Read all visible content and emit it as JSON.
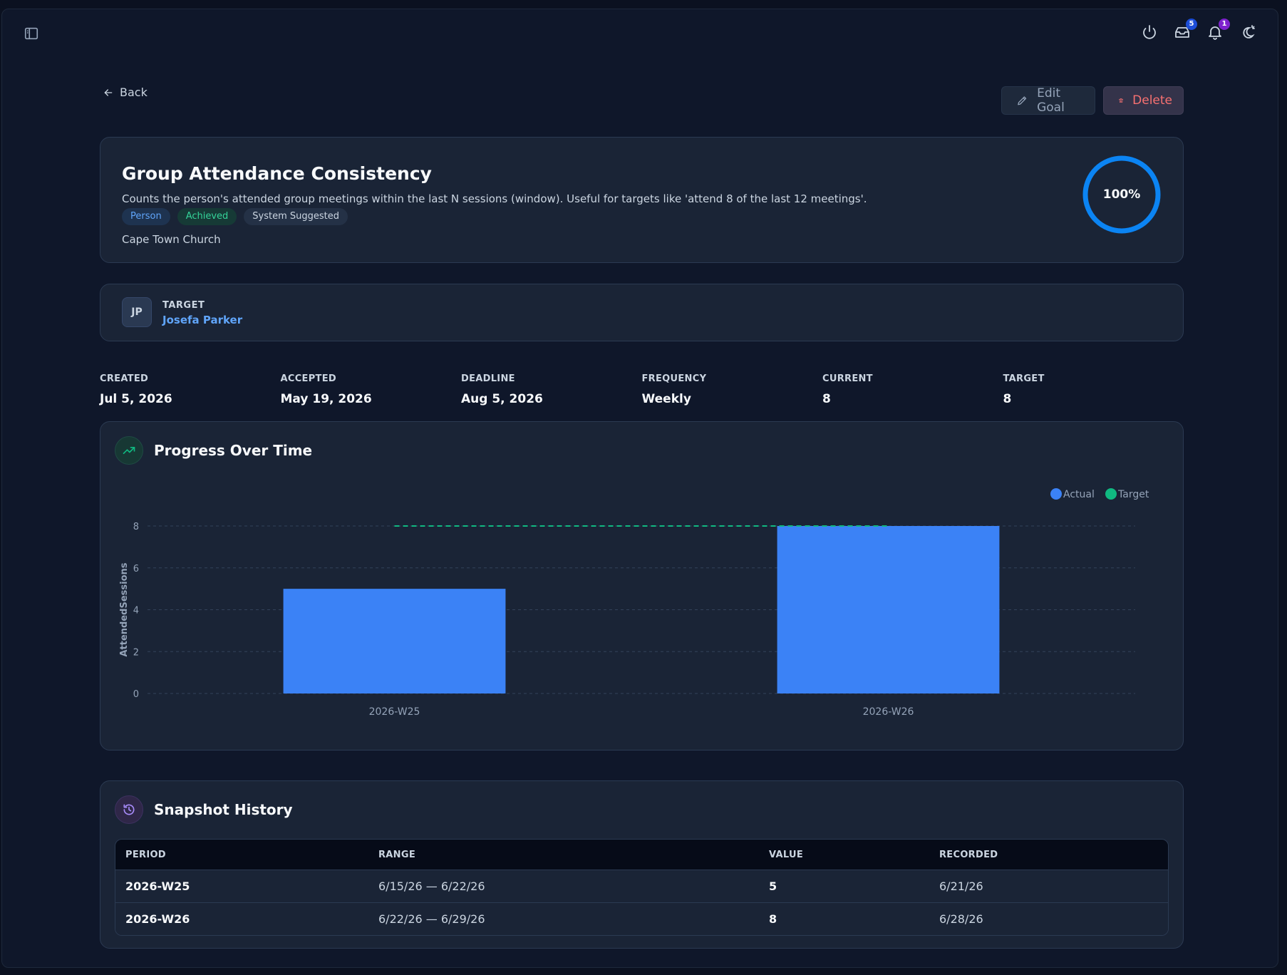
{
  "topbar": {
    "icons": [
      "sidebar-toggle-icon",
      "power-icon",
      "inbox-icon",
      "bell-icon",
      "theme-icon"
    ],
    "inbox_badge": "5",
    "bell_badge": "1"
  },
  "nav": {
    "back_label": "Back"
  },
  "actions": {
    "edit_label": "Edit Goal",
    "delete_label": "Delete"
  },
  "goal": {
    "title": "Group Attendance Consistency",
    "description": "Counts the person's attended group meetings within the last N sessions (window). Useful for targets like 'attend 8 of the last 12 meetings'.",
    "tags": {
      "person": "Person",
      "achieved": "Achieved",
      "system": "System Suggested"
    },
    "organization": "Cape Town Church",
    "progress_label": "100%",
    "progress": 1.0
  },
  "target_card": {
    "label": "TARGET",
    "initials": "JP",
    "name": "Josefa Parker"
  },
  "stats": [
    {
      "label": "CREATED",
      "value": "Jul 5, 2026"
    },
    {
      "label": "ACCEPTED",
      "value": "May 19, 2026"
    },
    {
      "label": "DEADLINE",
      "value": "Aug 5, 2026"
    },
    {
      "label": "FREQUENCY",
      "value": "Weekly"
    },
    {
      "label": "CURRENT",
      "value": "8"
    },
    {
      "label": "TARGET",
      "value": "8"
    }
  ],
  "progress_section": {
    "title": "Progress Over Time"
  },
  "chart_data": {
    "type": "bar",
    "categories": [
      "2026-W25",
      "2026-W26"
    ],
    "series": [
      {
        "name": "Actual",
        "values": [
          5,
          8
        ],
        "color": "#3b82f6"
      },
      {
        "name": "Target",
        "values": [
          8,
          8
        ],
        "color": "#10b981",
        "style": "dashed-line"
      }
    ],
    "ylabel": "AttendedSessions",
    "xlabel": "",
    "ylim": [
      0,
      8
    ],
    "yticks": [
      "0",
      "2",
      "4",
      "6",
      "8"
    ],
    "grid": true,
    "legend": "top-right"
  },
  "history": {
    "title": "Snapshot History",
    "headers": [
      "PERIOD",
      "RANGE",
      "VALUE",
      "RECORDED"
    ],
    "rows": [
      {
        "period": "2026-W25",
        "range": "6/15/26 — 6/22/26",
        "value": "5",
        "recorded": "6/21/26"
      },
      {
        "period": "2026-W26",
        "range": "6/22/26 — 6/29/26",
        "value": "8",
        "recorded": "6/28/26"
      }
    ]
  },
  "colors": {
    "accent": "#3b82f6",
    "success": "#10b981",
    "danger": "#f87171",
    "ring": "#0b84f3"
  }
}
